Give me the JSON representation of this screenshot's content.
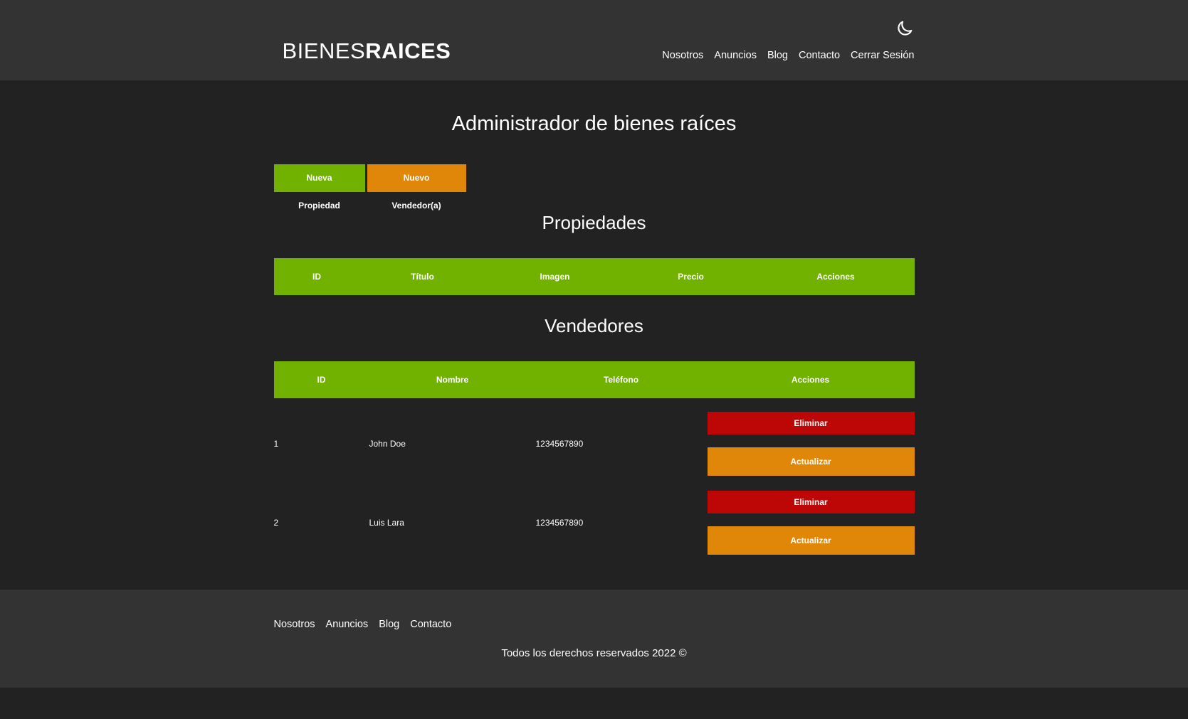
{
  "header": {
    "logo_light": "BIENES",
    "logo_bold": "RAICES",
    "nav": [
      "Nosotros",
      "Anuncios",
      "Blog",
      "Contacto",
      "Cerrar Sesión"
    ]
  },
  "main": {
    "title": "Administrador de bienes raíces",
    "buttons": {
      "new_property": "Nueva Propiedad",
      "new_seller": "Nuevo Vendedor(a)"
    },
    "properties": {
      "title": "Propiedades",
      "columns": [
        "ID",
        "Título",
        "Imagen",
        "Precio",
        "Acciones"
      ]
    },
    "sellers": {
      "title": "Vendedores",
      "columns": [
        "ID",
        "Nombre",
        "Teléfono",
        "Acciones"
      ],
      "rows": [
        {
          "id": "1",
          "name": "John Doe",
          "phone": "1234567890",
          "delete": "Eliminar",
          "update": "Actualizar"
        },
        {
          "id": "2",
          "name": "Luis Lara",
          "phone": "1234567890",
          "delete": "Eliminar",
          "update": "Actualizar"
        }
      ]
    }
  },
  "footer": {
    "nav": [
      "Nosotros",
      "Anuncios",
      "Blog",
      "Contacto"
    ],
    "copyright": "Todos los derechos reservados 2022 ©"
  },
  "colors": {
    "green": "#71b100",
    "orange": "#e08709",
    "red": "#bd0707",
    "header_bg": "#333333",
    "body_bg": "#222222"
  },
  "icons": {
    "theme_toggle": "moon-icon"
  }
}
